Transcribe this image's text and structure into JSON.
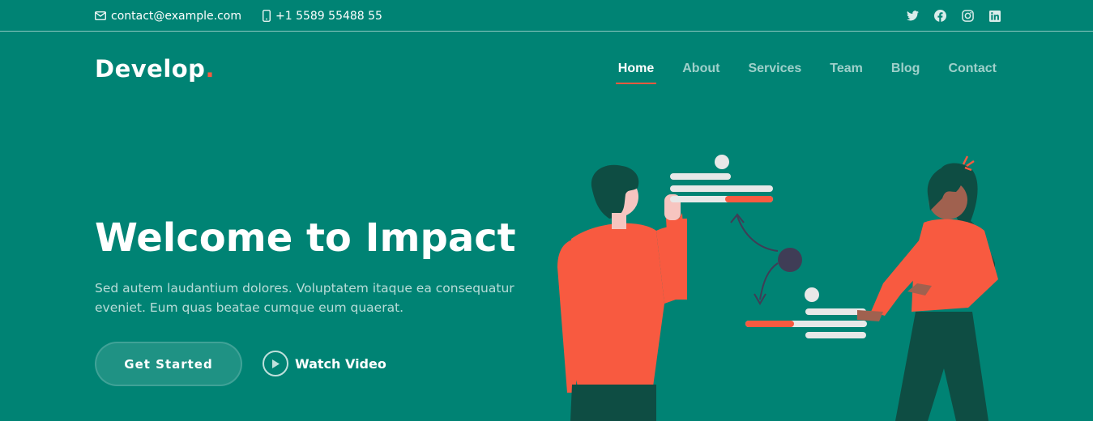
{
  "topbar": {
    "email": "contact@example.com",
    "phone": "+1 5589 55488 55",
    "social": [
      "twitter-icon",
      "facebook-icon",
      "instagram-icon",
      "linkedin-icon"
    ]
  },
  "header": {
    "logo_text": "Develop",
    "logo_dot": ".",
    "nav": {
      "home": "Home",
      "about": "About",
      "services": "Services",
      "team": "Team",
      "blog": "Blog",
      "contact": "Contact"
    },
    "active_nav": "Home"
  },
  "hero": {
    "title": "Welcome to Impact",
    "subtitle": "Sed autem laudantium dolores. Voluptatem itaque ea consequatur eveniet. Eum quas beatae cumque eum quaerat.",
    "primary_button": "Get Started",
    "video_button": "Watch Video"
  },
  "colors": {
    "background": "#008374",
    "accent": "#f85a40",
    "dark_green": "#0e4d43"
  }
}
